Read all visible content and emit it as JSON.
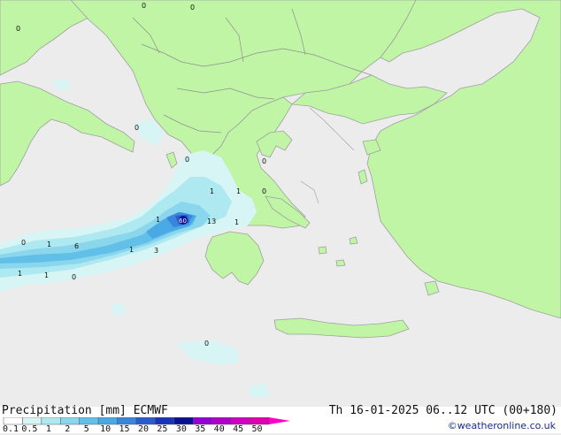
{
  "title": "Precipitation [mm] ECMWF",
  "valid_time": "Th 16-01-2025 06..12 UTC (00+180)",
  "credit": "©weatheronline.co.uk",
  "legend": {
    "ticks": [
      "0.1",
      "0.5",
      "1",
      "2",
      "5",
      "10",
      "15",
      "20",
      "25",
      "30",
      "35",
      "40",
      "45",
      "50"
    ],
    "colors": [
      "#ffffff",
      "#d8f5f5",
      "#aee8f0",
      "#8ad6ec",
      "#62c0e8",
      "#4aa8e4",
      "#3a86dc",
      "#2a5ccc",
      "#1a34b8",
      "#0a1290",
      "#9400d3",
      "#b000c8",
      "#d000c0",
      "#e000b0",
      "#f000a8",
      "#ff00c8"
    ]
  },
  "map_labels": [
    {
      "id": "m1",
      "text": "0"
    },
    {
      "id": "m2",
      "text": "0"
    },
    {
      "id": "m3",
      "text": "0"
    },
    {
      "id": "m4",
      "text": "0"
    },
    {
      "id": "m5",
      "text": "0"
    },
    {
      "id": "m6",
      "text": "0"
    },
    {
      "id": "m7",
      "text": "1"
    },
    {
      "id": "m8",
      "text": "1"
    },
    {
      "id": "m9",
      "text": "0"
    },
    {
      "id": "m10",
      "text": "1"
    },
    {
      "id": "m11",
      "text": "60"
    },
    {
      "id": "m12",
      "text": "13"
    },
    {
      "id": "m13",
      "text": "1"
    },
    {
      "id": "m14",
      "text": "0"
    },
    {
      "id": "m15",
      "text": "1"
    },
    {
      "id": "m16",
      "text": "6"
    },
    {
      "id": "m17",
      "text": "1"
    },
    {
      "id": "m18",
      "text": "3"
    },
    {
      "id": "m19",
      "text": "1"
    },
    {
      "id": "m20",
      "text": "1"
    },
    {
      "id": "m21",
      "text": "0"
    },
    {
      "id": "m22",
      "text": "0"
    }
  ],
  "colors": {
    "land": "#bff5a5",
    "sea": "#ececec",
    "border": "#909090",
    "coast": "#a0a0a0"
  }
}
